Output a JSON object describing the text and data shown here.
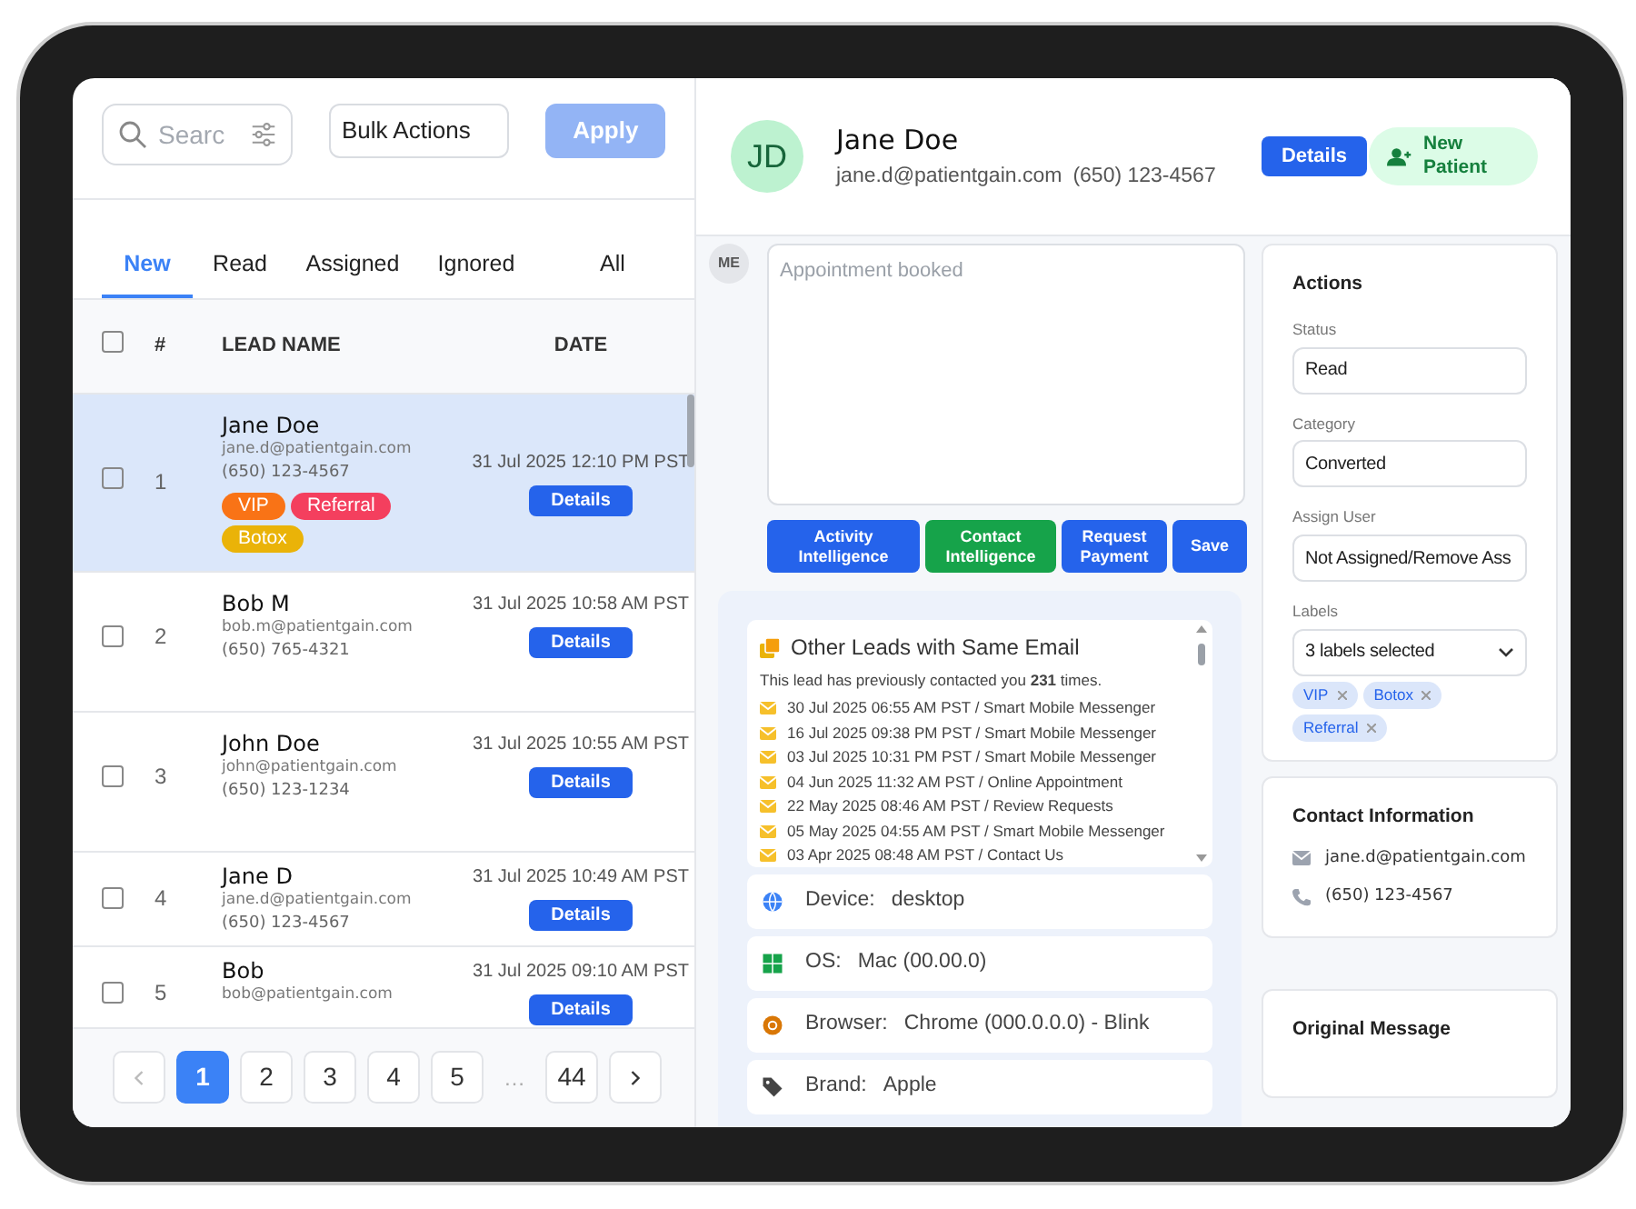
{
  "search": {
    "placeholder": "Searc"
  },
  "bulk_actions": {
    "value": "Bulk Actions"
  },
  "apply_button": {
    "label": "Apply",
    "disabled": true
  },
  "tabs": [
    {
      "label": "New",
      "selected": true
    },
    {
      "label": "Read",
      "selected": false
    },
    {
      "label": "Assigned",
      "selected": false
    },
    {
      "label": "Ignored",
      "selected": false
    },
    {
      "label": "All",
      "selected": false
    }
  ],
  "table": {
    "columns": [
      "#",
      "LEAD NAME",
      "DATE"
    ],
    "header_checked": false,
    "rows": [
      {
        "number": "1",
        "name": "Jane Doe",
        "email": "jane.d@patientgain.com",
        "phone": "(650) 123-4567",
        "date": "31 Jul 2025 12:10 PM PST",
        "details": "Details",
        "selected": true,
        "checked": false,
        "tags": [
          {
            "label": "VIP",
            "color": "#f97316"
          },
          {
            "label": "Referral",
            "color": "#f43f5e"
          },
          {
            "label": "Botox",
            "color": "#eab308"
          }
        ]
      },
      {
        "number": "2",
        "name": "Bob M",
        "email": "bob.m@patientgain.com",
        "phone": "(650) 765-4321",
        "date": "31 Jul 2025 10:58 AM PST",
        "details": "Details",
        "selected": false,
        "checked": false,
        "tags": []
      },
      {
        "number": "3",
        "name": "John Doe",
        "email": "john@patientgain.com",
        "phone": "(650) 123-1234",
        "date": "31 Jul 2025 10:55 AM PST",
        "details": "Details",
        "selected": false,
        "checked": false,
        "tags": []
      },
      {
        "number": "4",
        "name": "Jane D",
        "email": "jane.d@patientgain.com",
        "phone": "(650) 123-4567",
        "date": "31 Jul 2025 10:49 AM PST",
        "details": "Details",
        "selected": false,
        "checked": false,
        "tags": []
      },
      {
        "number": "5",
        "name": "Bob",
        "email": "bob@patientgain.com",
        "date": "31 Jul 2025 09:10 AM PST",
        "details": "Details",
        "selected": false,
        "checked": false,
        "tags": []
      }
    ]
  },
  "pagination": {
    "prev_disabled": true,
    "pages": [
      {
        "label": "1",
        "selected": true
      },
      {
        "label": "2",
        "selected": false
      },
      {
        "label": "3",
        "selected": false
      },
      {
        "label": "4",
        "selected": false
      },
      {
        "label": "5",
        "selected": false
      },
      {
        "label": "…",
        "kind": "ellipsis"
      },
      {
        "label": "44",
        "selected": false
      }
    ]
  },
  "lead": {
    "initials": "JD",
    "name": "Jane Doe",
    "email": "jane.d@patientgain.com",
    "phone": "(650) 123-4567",
    "details_button": "Details",
    "new_patient_button": "New Patient"
  },
  "composer": {
    "avatar": "ME",
    "placeholder": "Appointment booked",
    "buttons": [
      {
        "label": "Activity Intelligence",
        "kind": "primary"
      },
      {
        "label": "Contact Intelligence",
        "kind": "success"
      },
      {
        "label": "Request Payment",
        "kind": "primary"
      },
      {
        "label": "Save",
        "kind": "primary"
      }
    ]
  },
  "other_leads": {
    "title": "Other Leads with Same Email",
    "summary": "This lead has previously contacted you **231** times.",
    "entries": [
      "30 Jul 2025 06:55 AM PST / Smart Mobile Messenger",
      "16 Jul 2025 09:38 PM PST / Smart Mobile Messenger",
      "03 Jul 2025 10:31 PM PST / Smart Mobile Messenger",
      "04 Jun 2025 11:32 AM PST / Online Appointment",
      "22 May 2025 08:46 AM PST / Review Requests",
      "05 May 2025 04:55 AM PST / Smart Mobile Messenger",
      "03 Apr 2025 08:48 AM PST / Contact Us"
    ]
  },
  "device_info": [
    {
      "kind": "device",
      "label": "Device:",
      "value": "desktop"
    },
    {
      "kind": "os",
      "label": "OS:",
      "value": "Mac (00.00.0)"
    },
    {
      "kind": "browser",
      "label": "Browser:",
      "value": "Chrome (000.0.0.0) - Blink"
    },
    {
      "kind": "brand",
      "label": "Brand:",
      "value": "Apple"
    }
  ],
  "actions": {
    "title": "Actions",
    "fields": [
      {
        "label": "Status",
        "value": "Read"
      },
      {
        "label": "Category",
        "value": "Converted"
      },
      {
        "label": "Assign User",
        "value": "Not Assigned/Remove Ass"
      }
    ],
    "labels": {
      "label": "Labels",
      "value": "3 labels selected",
      "chips": [
        "VIP",
        "Botox",
        "Referral"
      ]
    }
  },
  "contact": {
    "title": "Contact Information",
    "email": "jane.d@patientgain.com",
    "phone": "(650) 123-4567"
  },
  "original_message": {
    "title": "Original Message"
  }
}
